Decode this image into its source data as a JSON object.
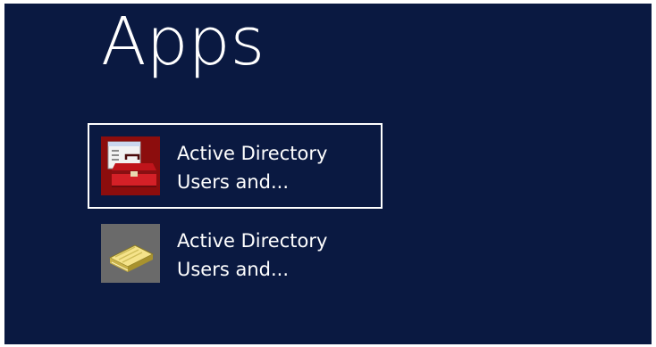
{
  "page": {
    "title": "Apps"
  },
  "apps": [
    {
      "line1": "Active Directory",
      "line2": "Users and...",
      "icon": "toolbox-icon",
      "icon_bg": "#8c0d0d",
      "selected": true
    },
    {
      "line1": "Active Directory",
      "line2": "Users and...",
      "icon": "directory-book-icon",
      "icon_bg": "#6a6a6a",
      "selected": false
    }
  ],
  "colors": {
    "background": "#0a1941",
    "text": "#ffffff",
    "selection_border": "#ffffff"
  }
}
